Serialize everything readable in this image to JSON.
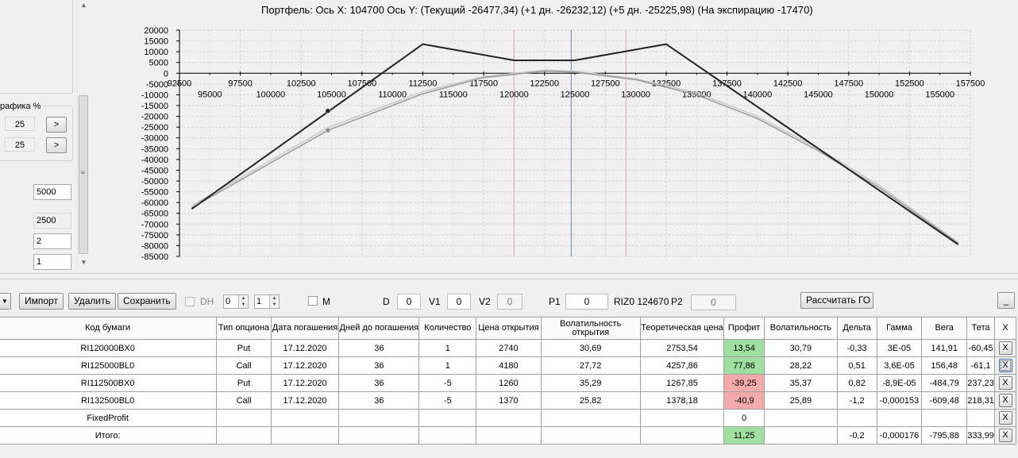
{
  "left_panel": {
    "pct_label": "рафика %",
    "pct_values": [
      "25",
      "25"
    ],
    "pct_btn": ">",
    "inputs": [
      "5000",
      "2500",
      "2",
      "1"
    ]
  },
  "chart": {
    "title": "Портфель: Ось X:  104700 Ось Y:  (Текущий -26477,34)  (+1 дн. -26232,12)  (+5 дн. -25225,98)  (На экспирацию -17470)"
  },
  "chart_data": {
    "type": "line",
    "title": "Портфель: Ось X:  104700 Ось Y:  (Текущий -26477,34)  (+1 дн. -26232,12)  (+5 дн. -25225,98)  (На экспирацию -17470)",
    "xlim": [
      92500,
      157500
    ],
    "ylim": [
      -85000,
      20000
    ],
    "x_ticks_upper": [
      92500,
      97500,
      102500,
      107500,
      112500,
      117500,
      122500,
      127500,
      132500,
      137500,
      142500,
      147500,
      152500,
      157500
    ],
    "x_ticks_lower": [
      95000,
      100000,
      105000,
      110000,
      115000,
      120000,
      125000,
      130000,
      135000,
      140000,
      145000,
      150000,
      155000
    ],
    "y_ticks": [
      20000,
      15000,
      10000,
      5000,
      0,
      -5000,
      -10000,
      -15000,
      -20000,
      -25000,
      -30000,
      -35000,
      -40000,
      -45000,
      -50000,
      -55000,
      -60000,
      -65000,
      -70000,
      -75000,
      -80000,
      -85000
    ],
    "grid": true,
    "vertical_markers": [
      {
        "x": 120000,
        "color": "#f0a0b0"
      },
      {
        "x": 124700,
        "color": "#7080b0"
      },
      {
        "x": 129200,
        "color": "#f0a0b0"
      }
    ],
    "series": [
      {
        "color": "#222222",
        "points": [
          [
            93500,
            -63000
          ],
          [
            112500,
            13500
          ],
          [
            120000,
            6000
          ],
          [
            125000,
            6000
          ],
          [
            132500,
            13500
          ],
          [
            156500,
            -79500
          ]
        ]
      },
      {
        "color": "#999999",
        "points": [
          [
            93500,
            -62500
          ],
          [
            104700,
            -26477
          ],
          [
            112500,
            -9500
          ],
          [
            117500,
            -2000
          ],
          [
            122500,
            1000
          ],
          [
            125000,
            500
          ],
          [
            130000,
            -3000
          ],
          [
            135000,
            -10000
          ],
          [
            140000,
            -21000
          ],
          [
            145000,
            -36000
          ],
          [
            150000,
            -53000
          ],
          [
            156500,
            -79000
          ]
        ]
      },
      {
        "color": "#c8c8c8",
        "points": [
          [
            93500,
            -61500
          ],
          [
            104700,
            -25226
          ],
          [
            112500,
            -8500
          ],
          [
            117500,
            -1500
          ],
          [
            122500,
            1500
          ],
          [
            125000,
            1000
          ],
          [
            130000,
            -2500
          ],
          [
            135000,
            -9000
          ],
          [
            140000,
            -20000
          ],
          [
            145000,
            -35000
          ],
          [
            150000,
            -52000
          ],
          [
            156500,
            -78500
          ]
        ]
      }
    ],
    "markers": [
      {
        "x": 104700,
        "y": -17470,
        "color": "#222222"
      },
      {
        "x": 104700,
        "y": -26477,
        "color": "#888888"
      }
    ]
  },
  "toolbar": {
    "import_label": "Импорт",
    "delete_label": "Удалить",
    "save_label": "Сохранить",
    "dh_label": "DH",
    "spin1": "0",
    "spin2": "1",
    "m_label": "M",
    "d_label": "D",
    "d_value": "0",
    "v1_label": "V1",
    "v1_value": "0",
    "v2_label": "V2",
    "v2_value": "0",
    "p1_label": "P1",
    "p1_value": "0",
    "riz_label": "RIZ0 124670",
    "p2_label": "P2",
    "p2_value": "0",
    "calc_label": "Рассчитать ГО",
    "minimize_label": "_"
  },
  "grid": {
    "headers": [
      "Код бумаги",
      "Тип опциона",
      "Дата погашения",
      "Дней до погашения",
      "Количество",
      "Цена открытия",
      "Волатильность открытия",
      "Теоретическая цена",
      "Профит",
      "Волатильность",
      "Дельта",
      "Гамма",
      "Вега",
      "Тета",
      "X"
    ],
    "rows": [
      [
        "RI120000BX0",
        "Put",
        "17.12.2020",
        "36",
        "1",
        "2740",
        "30,69",
        "2753,54",
        "13,54",
        "30,79",
        "-0,33",
        "3E-05",
        "141,91",
        "-60,45"
      ],
      [
        "RI125000BL0",
        "Call",
        "17.12.2020",
        "36",
        "1",
        "4180",
        "27,72",
        "4257,86",
        "77,86",
        "28,22",
        "0,51",
        "3,6E-05",
        "156,48",
        "-61,1"
      ],
      [
        "RI112500BX0",
        "Put",
        "17.12.2020",
        "36",
        "-5",
        "1260",
        "35,29",
        "1267,85",
        "-39,25",
        "35,37",
        "0,82",
        "-8,9E-05",
        "-484,79",
        "237,23"
      ],
      [
        "RI132500BL0",
        "Call",
        "17.12.2020",
        "36",
        "-5",
        "1370",
        "25,82",
        "1378,18",
        "-40,9",
        "25,89",
        "-1,2",
        "-0,000153",
        "-609,48",
        "218,31"
      ],
      [
        "FixedProfit",
        "",
        "",
        "",
        "",
        "",
        "",
        "",
        "0",
        "",
        "",
        "",
        "",
        ""
      ],
      [
        "Итого:",
        "",
        "",
        "",
        "",
        "",
        "",
        "",
        "11,25",
        "",
        "-0,2",
        "-0,000176",
        "-795,88",
        "333,99"
      ]
    ],
    "profit_status": [
      "pos",
      "pos",
      "neg",
      "neg",
      "none",
      "pos"
    ],
    "x_label": "X"
  }
}
